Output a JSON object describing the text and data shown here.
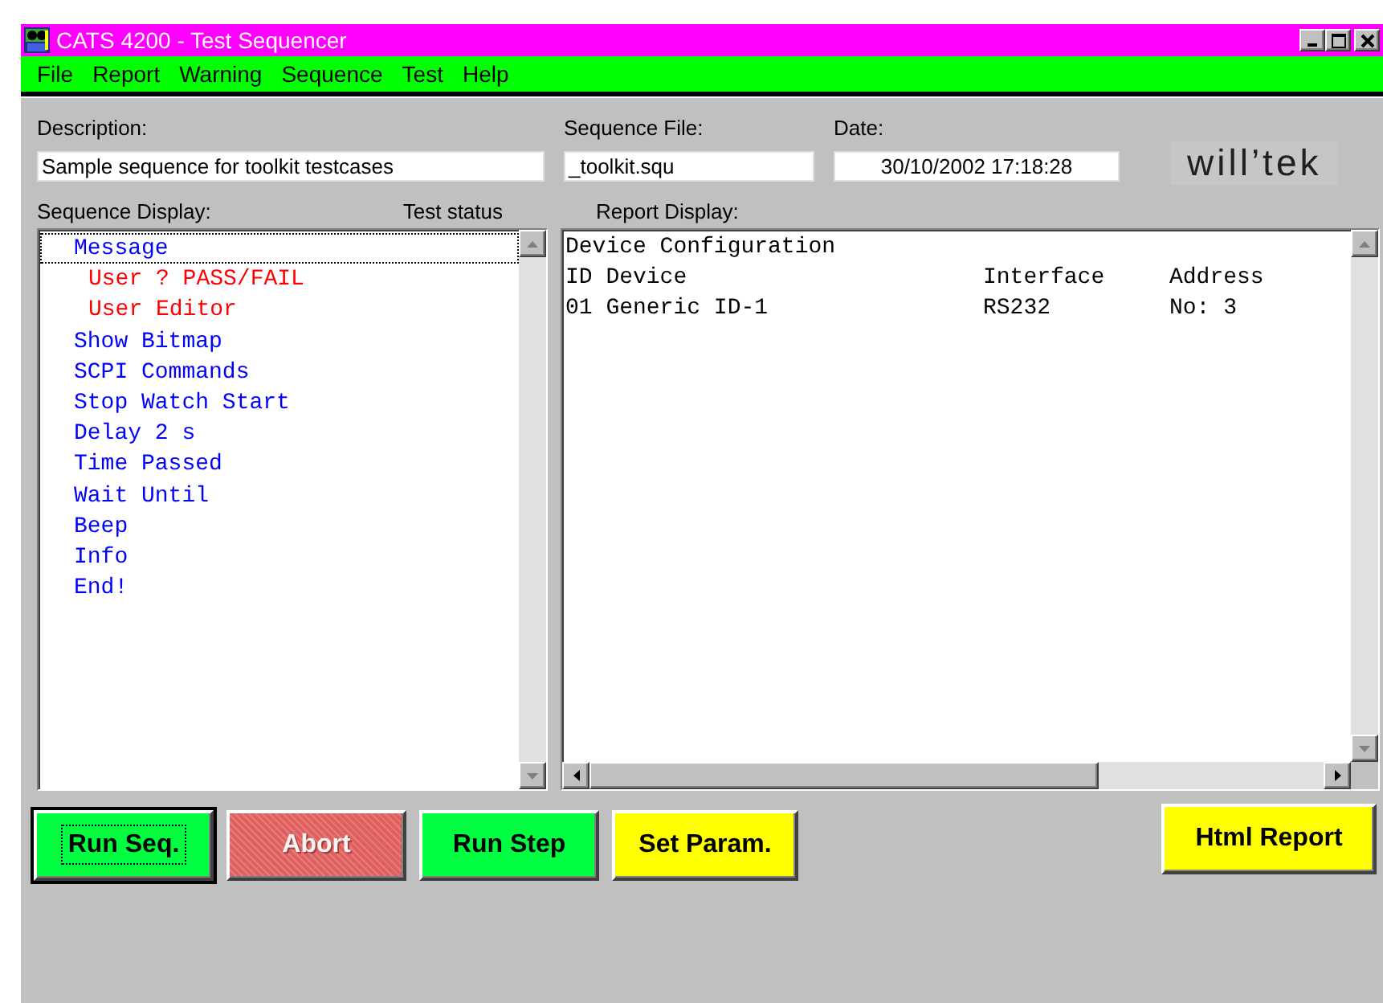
{
  "window": {
    "title": "CATS 4200 - Test Sequencer"
  },
  "menu": [
    {
      "label": "File"
    },
    {
      "label": "Report"
    },
    {
      "label": "Warning"
    },
    {
      "label": "Sequence"
    },
    {
      "label": "Test"
    },
    {
      "label": "Help"
    }
  ],
  "fields": [
    {
      "label": "Description:",
      "value": "Sample sequence for toolkit testcases"
    },
    {
      "label": "Sequence File:",
      "value": "_toolkit.squ"
    },
    {
      "label": "Date:",
      "value": "30/10/2002 17:18:28"
    }
  ],
  "logo": "will’tek",
  "sequence": {
    "label": "Sequence Display:",
    "status_label": "Test status",
    "items": [
      {
        "text": "Message",
        "color": "#0000ff",
        "selected": true,
        "children": [
          {
            "text": "User ? PASS/FAIL",
            "color": "#ff0000",
            "selected": false
          },
          {
            "text": "User Editor",
            "color": "#ff0000",
            "selected": false
          }
        ]
      },
      {
        "text": "Show Bitmap",
        "color": "#0000ff",
        "selected": false
      },
      {
        "text": "SCPI Commands",
        "color": "#0000ff",
        "selected": false
      },
      {
        "text": "Stop Watch Start",
        "color": "#0000ff",
        "selected": false
      },
      {
        "text": "Delay 2 s",
        "color": "#0000ff",
        "selected": false
      },
      {
        "text": "Time Passed",
        "color": "#0000ff",
        "selected": false
      },
      {
        "text": "Wait Until",
        "color": "#0000ff",
        "selected": false
      },
      {
        "text": "Beep",
        "color": "#0000ff",
        "selected": false
      },
      {
        "text": "Info",
        "color": "#0000ff",
        "selected": false
      },
      {
        "text": "End!",
        "color": "#0000ff",
        "selected": false
      }
    ]
  },
  "report": {
    "label": "Report Display:",
    "rows": [
      [
        "Device Configuration"
      ],
      [
        "ID Device",
        "Interface",
        "Address"
      ],
      [
        "01 Generic ID-1",
        "RS232",
        "No: 3"
      ]
    ]
  },
  "buttons": [
    {
      "label": "Run Seq.",
      "color": "#00ff40",
      "disabled": false,
      "default": true
    },
    {
      "label": "Abort",
      "color": "#e06060",
      "disabled": true,
      "default": false
    },
    {
      "label": "Run Step",
      "color": "#00ff40",
      "disabled": false,
      "default": false
    },
    {
      "label": "Set Param.",
      "color": "#ffff00",
      "disabled": false,
      "default": false
    }
  ],
  "report_button": {
    "label": "Html Report",
    "color": "#ffff00",
    "disabled": false,
    "default": false
  }
}
